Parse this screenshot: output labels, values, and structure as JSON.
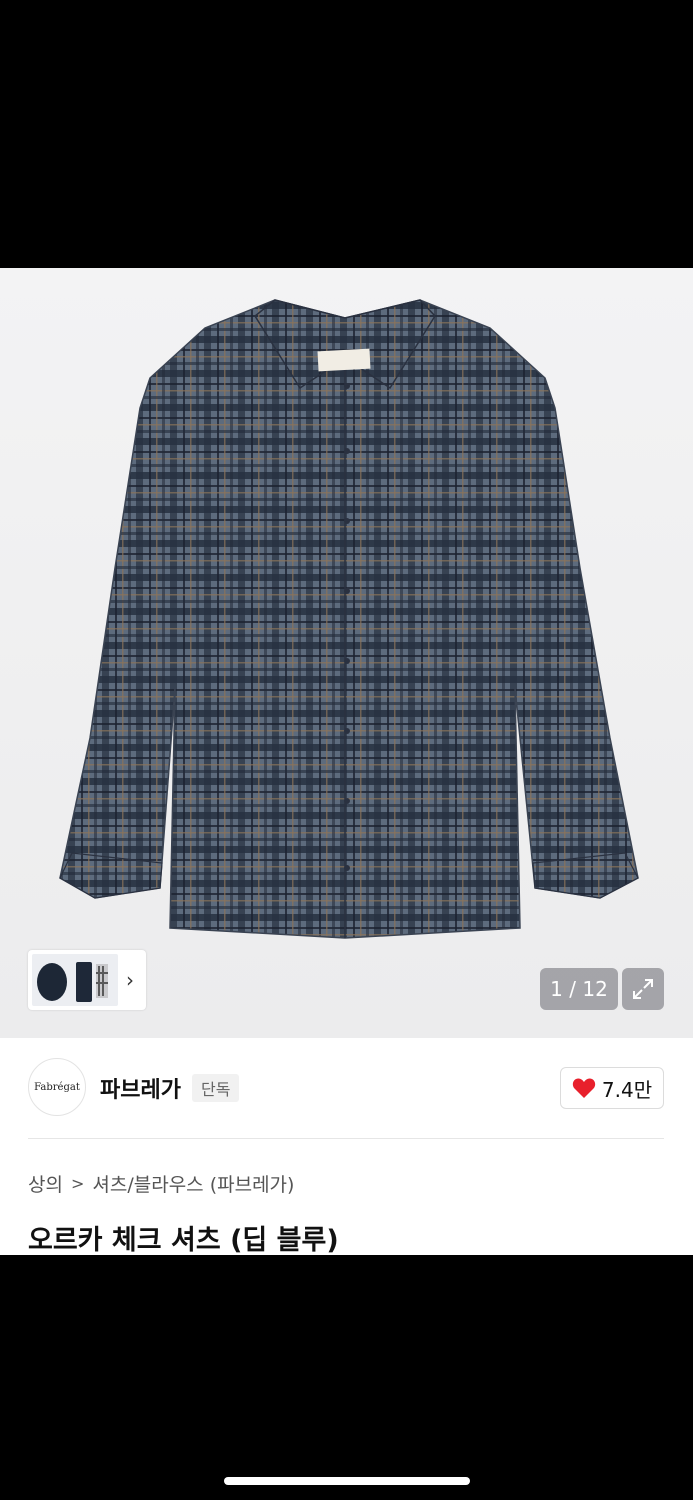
{
  "gallery": {
    "counter_current": "1",
    "counter_total": "12",
    "counter_text": "1 / 12",
    "shirt_colors": {
      "base": "#5b6a7c",
      "dark": "#1d2533",
      "light": "#7e8da0",
      "accent": "#8a6f55"
    }
  },
  "brand": {
    "logo_text": "Fabrégat",
    "name": "파브레가",
    "badge": "단독",
    "likes": "7.4만"
  },
  "breadcrumb": {
    "category": "상의",
    "subcategory": "셔츠/블라우스 (파브레가)"
  },
  "product": {
    "title": "오르카 체크 셔츠 (딥 블루)"
  },
  "colors": {
    "heart": "#e8202c"
  }
}
